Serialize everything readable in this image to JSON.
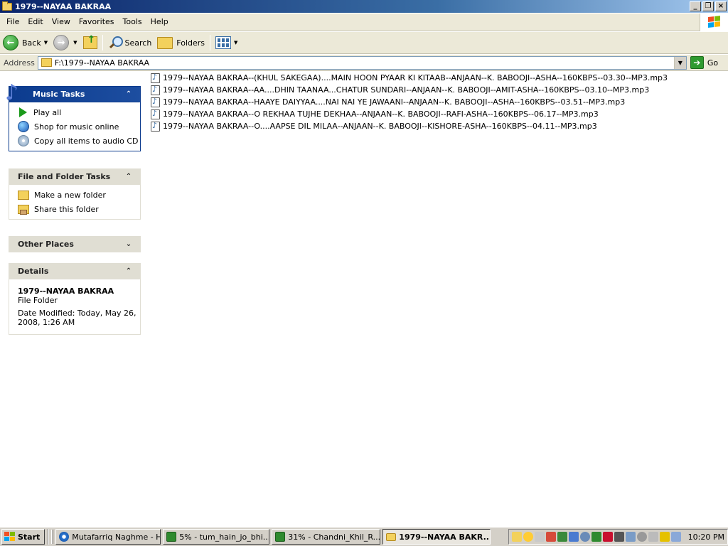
{
  "window": {
    "title": "1979--NAYAA BAKRAA",
    "controls": {
      "minimize": "_",
      "maximize": "❐",
      "close": "×"
    }
  },
  "menubar": {
    "items": [
      "File",
      "Edit",
      "View",
      "Favorites",
      "Tools",
      "Help"
    ]
  },
  "toolbar": {
    "back": "Back",
    "search": "Search",
    "folders": "Folders"
  },
  "address": {
    "label": "Address",
    "value": "F:\\1979--NAYAA BAKRAA",
    "go": "Go"
  },
  "taskpane": {
    "music_tasks": {
      "title": "Music Tasks",
      "items": [
        "Play all",
        "Shop for music online",
        "Copy all items to audio CD"
      ]
    },
    "file_folder_tasks": {
      "title": "File and Folder Tasks",
      "items": [
        "Make a new folder",
        "Share this folder"
      ]
    },
    "other_places": {
      "title": "Other Places"
    },
    "details": {
      "title": "Details",
      "name": "1979--NAYAA BAKRAA",
      "type": "File Folder",
      "modified_line1": "Date Modified: Today, May 26,",
      "modified_line2": "2008, 1:26 AM"
    }
  },
  "files": [
    "1979--NAYAA BAKRAA--(KHUL SAKEGAA)....MAIN HOON PYAAR KI KITAAB--ANJAAN--K. BABOOJI--ASHA--160KBPS--03.30--MP3.mp3",
    "1979--NAYAA BAKRAA--AA....DHIN TAANAA...CHATUR SUNDARI--ANJAAN--K. BABOOJI--AMIT-ASHA--160KBPS--03.10--MP3.mp3",
    "1979--NAYAA BAKRAA--HAAYE DAIYYAA....NAI NAI YE JAWAANI--ANJAAN--K. BABOOJI--ASHA--160KBPS--03.51--MP3.mp3",
    "1979--NAYAA BAKRAA--O REKHAA TUJHE DEKHAA--ANJAAN--K. BABOOJI--RAFI-ASHA--160KBPS--06.17--MP3.mp3",
    "1979--NAYAA BAKRAA--O....AAPSE DIL MILAA--ANJAAN--K. BABOOJI--KISHORE-ASHA--160KBPS--04.11--MP3.mp3"
  ],
  "taskbar": {
    "start": "Start",
    "tasks": [
      "Mutafarriq Naghme - H...",
      "5% - tum_hain_jo_bhi...",
      "31% - Chandni_Khil_R...",
      "1979--NAYAA BAKR..."
    ],
    "clock": "10:20 PM"
  },
  "colors": {
    "titlebar_start": "#0a246a",
    "task_header_special": "#0c3b8e",
    "chrome": "#ece9d8",
    "taskbar": "#d4d0c8"
  }
}
